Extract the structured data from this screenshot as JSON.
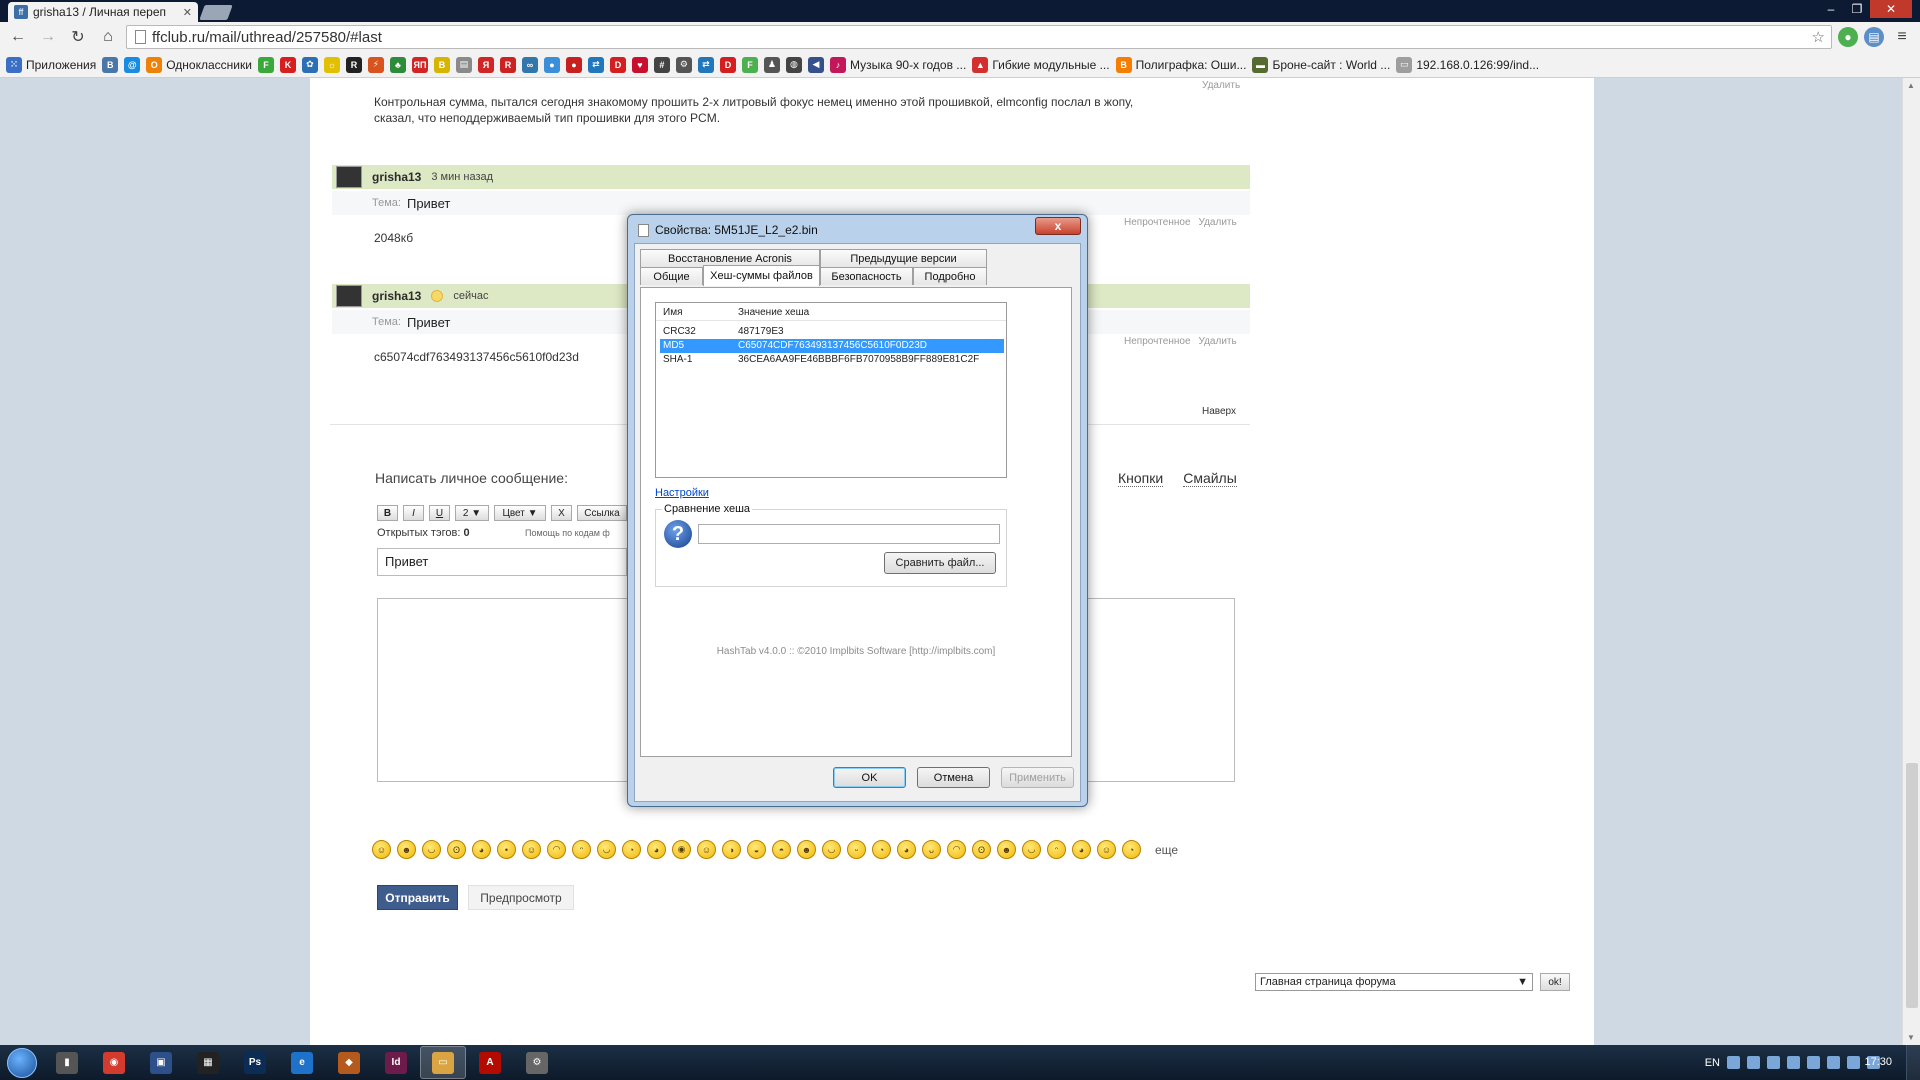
{
  "browser": {
    "tab_title": "grisha13 / Личная переп",
    "url": "ffclub.ru/mail/uthread/257580/#last",
    "apps_label": "Приложения",
    "bookmarks": [
      {
        "label": "",
        "icon": "vk-icon",
        "color": "#4a76a8",
        "text": "В"
      },
      {
        "label": "",
        "icon": "mail-icon",
        "color": "#168de2",
        "text": "@"
      },
      {
        "label": "Одноклассники",
        "icon": "ok-icon",
        "color": "#ee8208",
        "text": "О"
      },
      {
        "label": "",
        "icon": "green-f-icon",
        "color": "#3aa83a",
        "text": "F"
      },
      {
        "label": "",
        "icon": "kinopoisk-icon",
        "color": "#d61f1f",
        "text": "K"
      },
      {
        "label": "",
        "icon": "globe-icon",
        "color": "#2c6fb5",
        "text": "✿"
      },
      {
        "label": "",
        "icon": "yellow-icon",
        "color": "#e0c000",
        "text": "☼"
      },
      {
        "label": "",
        "icon": "r-icon",
        "color": "#222222",
        "text": "R"
      },
      {
        "label": "",
        "icon": "orange-icon",
        "color": "#d9531e",
        "text": "⚡"
      },
      {
        "label": "",
        "icon": "green-leaf-icon",
        "color": "#2e8b3a",
        "text": "♣"
      },
      {
        "label": "",
        "icon": "yap-icon",
        "color": "#d12626",
        "text": "ЯП"
      },
      {
        "label": "",
        "icon": "b-icon",
        "color": "#d7b400",
        "text": "B"
      },
      {
        "label": "",
        "icon": "page-icon",
        "color": "#8a8a8a",
        "text": "▤"
      },
      {
        "label": "",
        "icon": "yandex-icon",
        "color": "#d12626",
        "text": "Я"
      },
      {
        "label": "",
        "icon": "red-r-icon",
        "color": "#cc2222",
        "text": "R"
      },
      {
        "label": "",
        "icon": "bike-icon",
        "color": "#3377aa",
        "text": "∞"
      },
      {
        "label": "",
        "icon": "drop-icon",
        "color": "#3b8fd8",
        "text": "●"
      },
      {
        "label": "",
        "icon": "red-circle-icon",
        "color": "#c8201e",
        "text": "●"
      },
      {
        "label": "",
        "icon": "share-icon",
        "color": "#2277bb",
        "text": "⇄"
      },
      {
        "label": "",
        "icon": "d-icon",
        "color": "#d31f1f",
        "text": "D"
      },
      {
        "label": "",
        "icon": "heart-icon",
        "color": "#c8102e",
        "text": "♥"
      },
      {
        "label": "",
        "icon": "hash-icon",
        "color": "#444444",
        "text": "#"
      },
      {
        "label": "",
        "icon": "gear-icon",
        "color": "#555555",
        "text": "⚙"
      },
      {
        "label": "",
        "icon": "share2-icon",
        "color": "#2277bb",
        "text": "⇄"
      },
      {
        "label": "",
        "icon": "d2-icon",
        "color": "#d31f1f",
        "text": "D"
      },
      {
        "label": "",
        "icon": "f-green-icon",
        "color": "#4caf50",
        "text": "F"
      },
      {
        "label": "",
        "icon": "person-icon",
        "color": "#555555",
        "text": "♟"
      },
      {
        "label": "",
        "icon": "world-icon",
        "color": "#444444",
        "text": "◍"
      },
      {
        "label": "",
        "icon": "fish-icon",
        "color": "#35508a",
        "text": "◀"
      },
      {
        "label": "Музыка 90-х годов ...",
        "icon": "music-icon",
        "color": "#c2185b",
        "text": "♪"
      },
      {
        "label": "Гибкие модульные ...",
        "icon": "flame-icon",
        "color": "#d32f2f",
        "text": "▲"
      },
      {
        "label": "Полиграфка: Оши...",
        "icon": "blogger-icon",
        "color": "#f57d00",
        "text": "B"
      },
      {
        "label": "Броне-сайт : World ...",
        "icon": "tank-icon",
        "color": "#556b2f",
        "text": "▬"
      },
      {
        "label": "192.168.0.126:99/ind...",
        "icon": "doc-icon",
        "color": "#9e9e9e",
        "text": "▭"
      }
    ]
  },
  "thread": {
    "prev_text_line1": "Контрольная сумма, пытался сегодня знакомому прошить 2-х литровый фокус немец именно этой прошивкой, elmconfig послал в жопу,",
    "prev_text_line2": "сказал, что неподдерживаемый тип прошивки для этого PCM.",
    "prev_delete": "Удалить",
    "subject_label": "Тема:",
    "messages": [
      {
        "author": "grisha13",
        "time": "3 мин назад",
        "subject": "Привет",
        "body": "2048кб",
        "unread": "Непрочтенное",
        "delete": "Удалить"
      },
      {
        "author": "grisha13",
        "time": "сейчас",
        "subject": "Привет",
        "body": "c65074cdf763493137456c5610f0d23d",
        "unread": "Непрочтенное",
        "delete": "Удалить"
      }
    ],
    "to_top": "Наверх"
  },
  "compose": {
    "title": "Написать личное сообщение:",
    "link_buttons": "Кнопки",
    "link_smileys": "Смайлы",
    "fmt": {
      "bold": "B",
      "italic": "I",
      "underline": "U",
      "size": "2 ▼",
      "color": "Цвет ▼",
      "clear": "X",
      "link": "Ссылка"
    },
    "open_tags_label": "Открытых тэгов:",
    "open_tags_count": "0",
    "help_codes": "Помощь по кодам ф",
    "subject_value": "Привет",
    "smileys_more": "еще",
    "send": "Отправить",
    "preview": "Предпросмотр",
    "forum_select": "Главная страница форума",
    "forum_ok": "ok!"
  },
  "dialog": {
    "title": "Свойства: 5M51JE_L2_e2.bin",
    "close": "x",
    "tabs_row1": [
      "Восстановление Acronis",
      "Предыдущие версии"
    ],
    "tabs_row2": [
      "Общие",
      "Хеш-суммы файлов",
      "Безопасность",
      "Подробно"
    ],
    "col_name": "Имя",
    "col_value": "Значение хеша",
    "hashes": [
      {
        "name": "CRC32",
        "value": "487179E3"
      },
      {
        "name": "MD5",
        "value": "C65074CDF763493137456C5610F0D23D"
      },
      {
        "name": "SHA-1",
        "value": "36CEA6AA9FE46BBBF6FB7070958B9FF889E81C2F"
      }
    ],
    "settings_link": "Настройки",
    "compare_label": "Сравнение хеша",
    "compare_button": "Сравнить файл...",
    "credits": "HashTab v4.0.0 :: ©2010 Implbits Software [http://implbits.com]",
    "ok": "OK",
    "cancel": "Отмена",
    "apply": "Применить"
  },
  "taskbar": {
    "apps": [
      {
        "icon": "device-icon",
        "color": "#555555",
        "text": "▮"
      },
      {
        "icon": "chrome-icon",
        "color": "#d23b2e",
        "text": "◉"
      },
      {
        "icon": "floppy-icon",
        "color": "#2d4f8a",
        "text": "▣"
      },
      {
        "icon": "film-icon",
        "color": "#222222",
        "text": "▦"
      },
      {
        "icon": "photoshop-icon",
        "color": "#0b2d55",
        "text": "Ps"
      },
      {
        "icon": "ie-icon",
        "color": "#1e72c9",
        "text": "e"
      },
      {
        "icon": "vpn-icon",
        "color": "#b45a1c",
        "text": "◆"
      },
      {
        "icon": "indesign-icon",
        "color": "#6d1b4b",
        "text": "Id"
      },
      {
        "icon": "explorer-icon",
        "color": "#d9a441",
        "text": "▭"
      },
      {
        "icon": "acrobat-icon",
        "color": "#b30b00",
        "text": "A"
      },
      {
        "icon": "tools-icon",
        "color": "#666666",
        "text": "⚙"
      }
    ],
    "lang": "EN",
    "clock": "17:30"
  }
}
